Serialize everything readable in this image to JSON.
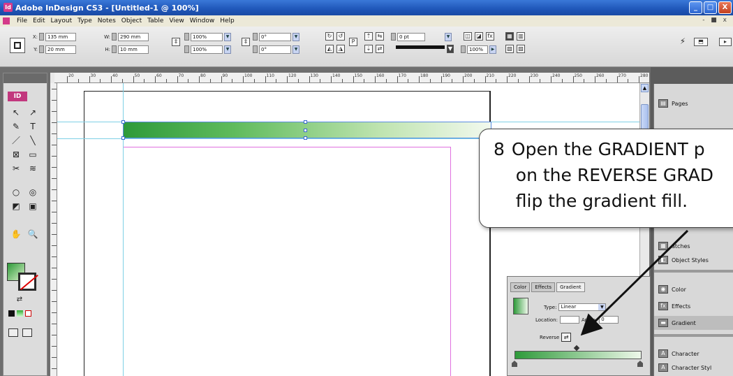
{
  "window": {
    "title": "Adobe InDesign CS3 - [Untitled-1 @ 100%]",
    "app_icon_label": "Id",
    "controls": [
      "_",
      "□",
      "X"
    ]
  },
  "menubar": {
    "items": [
      "File",
      "Edit",
      "Layout",
      "Type",
      "Notes",
      "Object",
      "Table",
      "View",
      "Window",
      "Help"
    ],
    "mdi_controls": "- ■ x"
  },
  "controlbar": {
    "x_value": "135 mm",
    "y_value": "20 mm",
    "w_value": "290 mm",
    "h_value": "10 mm",
    "scale_x": "100%",
    "scale_y": "100%",
    "rotate": "0°",
    "shear": "0°",
    "stroke_weight": "0 pt",
    "opacity": "100%",
    "x_label": "X:",
    "y_label": "Y:",
    "w_label": "W:",
    "h_label": "H:"
  },
  "ruler": {
    "labels": [
      "20",
      "30",
      "40",
      "50",
      "60",
      "70",
      "80",
      "90",
      "100",
      "110",
      "120",
      "130",
      "140",
      "150",
      "160",
      "170",
      "180",
      "190",
      "200",
      "210",
      "220",
      "230",
      "240",
      "250",
      "260",
      "270",
      "280"
    ]
  },
  "tools": {
    "logo": "ID",
    "glyphs": [
      "↖",
      "↗",
      "✎",
      "T",
      "／",
      "╲",
      "⊠",
      "▭",
      "✂",
      "≋",
      "○",
      "◎",
      "◩",
      "▣",
      "✋",
      "🔍"
    ]
  },
  "dock": {
    "items": [
      {
        "label": "Pages",
        "icon": "pages-icon",
        "glyph": "▤"
      },
      {
        "label": "atches",
        "icon": "swatches-icon",
        "glyph": "▦"
      },
      {
        "label": "Object Styles",
        "icon": "object-styles-icon",
        "glyph": "◧"
      },
      {
        "label": "Color",
        "icon": "color-icon",
        "glyph": "◉"
      },
      {
        "label": "Effects",
        "icon": "effects-icon",
        "glyph": "fx"
      },
      {
        "label": "Gradient",
        "icon": "gradient-icon",
        "glyph": "▬"
      },
      {
        "label": "Character",
        "icon": "character-icon",
        "glyph": "A"
      },
      {
        "label": "Character Styl",
        "icon": "character-styles-icon",
        "glyph": "A"
      }
    ]
  },
  "gradient_panel": {
    "tabs": [
      "Color",
      "Effects",
      "Gradient"
    ],
    "type_label": "Type:",
    "type_value": "Linear",
    "location_label": "Location:",
    "angle_label": "Angle:",
    "angle_value": "0",
    "reverse_label": "Reverse"
  },
  "callout": {
    "step": "8",
    "line1": "Open the GRADIENT p",
    "line2": "on the REVERSE GRAD",
    "line3": "flip the gradient fill."
  },
  "colors": {
    "gradient_start": "#2e9a3a",
    "gradient_end": "#f2f9ee",
    "guide": "#7fd0e6",
    "margin": "#e070e0",
    "titlebar": "#1f56b8"
  }
}
